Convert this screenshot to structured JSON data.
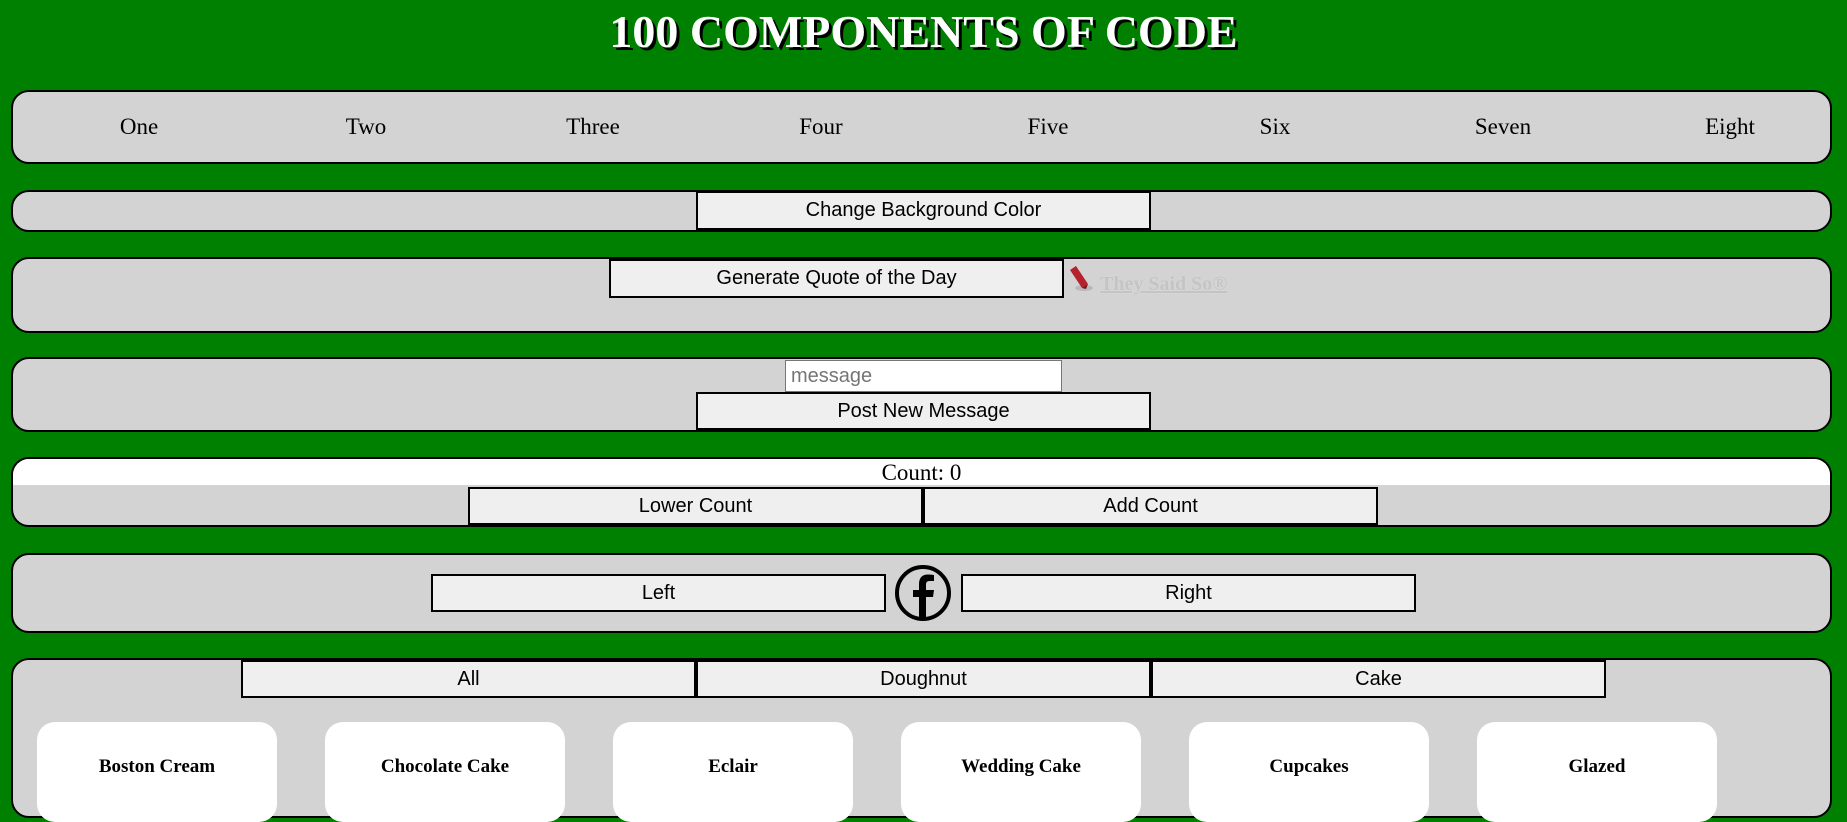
{
  "page": {
    "title": "100 COMPONENTS OF CODE"
  },
  "nav": {
    "items": [
      "One",
      "Two",
      "Three",
      "Four",
      "Five",
      "Six",
      "Seven",
      "Eight"
    ]
  },
  "background": {
    "change_label": "Change Background Color"
  },
  "quote": {
    "generate_label": "Generate Quote of the Day",
    "source_text": "They Said So®",
    "icon": "they-said-so-logo-icon"
  },
  "message": {
    "placeholder": "message",
    "value": "",
    "post_label": "Post New Message"
  },
  "counter": {
    "text": "Count: 0",
    "value": 0,
    "lower_label": "Lower Count",
    "add_label": "Add Count"
  },
  "slider": {
    "left_label": "Left",
    "right_label": "Right",
    "icon": "facebook-icon"
  },
  "filter": {
    "buttons": [
      "All",
      "Doughnut",
      "Cake"
    ],
    "cards": [
      "Boston Cream",
      "Chocolate Cake",
      "Eclair",
      "Wedding Cake",
      "Cupcakes",
      "Glazed"
    ]
  },
  "colors": {
    "background": "#008000",
    "panel": "#d3d3d3",
    "button": "#efefef",
    "card": "#ffffff"
  }
}
